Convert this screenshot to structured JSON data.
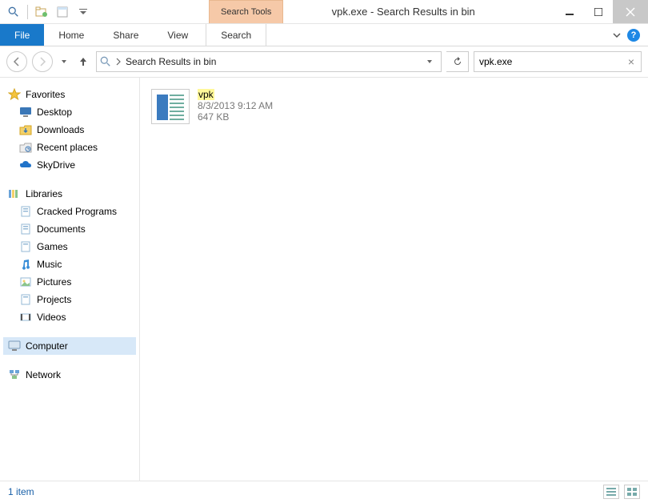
{
  "window": {
    "title": "vpk.exe - Search Results in bin",
    "contextual_tab": "Search Tools"
  },
  "ribbon": {
    "file": "File",
    "tabs": [
      "Home",
      "Share",
      "View"
    ],
    "search_tab": "Search"
  },
  "nav": {
    "breadcrumb": "Search Results in bin",
    "search_value": "vpk.exe"
  },
  "navpane": {
    "favorites": {
      "label": "Favorites",
      "items": [
        "Desktop",
        "Downloads",
        "Recent places",
        "SkyDrive"
      ]
    },
    "libraries": {
      "label": "Libraries",
      "items": [
        "Cracked Programs",
        "Documents",
        "Games",
        "Music",
        "Pictures",
        "Projects",
        "Videos"
      ]
    },
    "computer": {
      "label": "Computer"
    },
    "network": {
      "label": "Network"
    }
  },
  "results": [
    {
      "name": "vpk",
      "date": "8/3/2013 9:12 AM",
      "size": "647 KB"
    }
  ],
  "status": {
    "count": "1 item"
  }
}
